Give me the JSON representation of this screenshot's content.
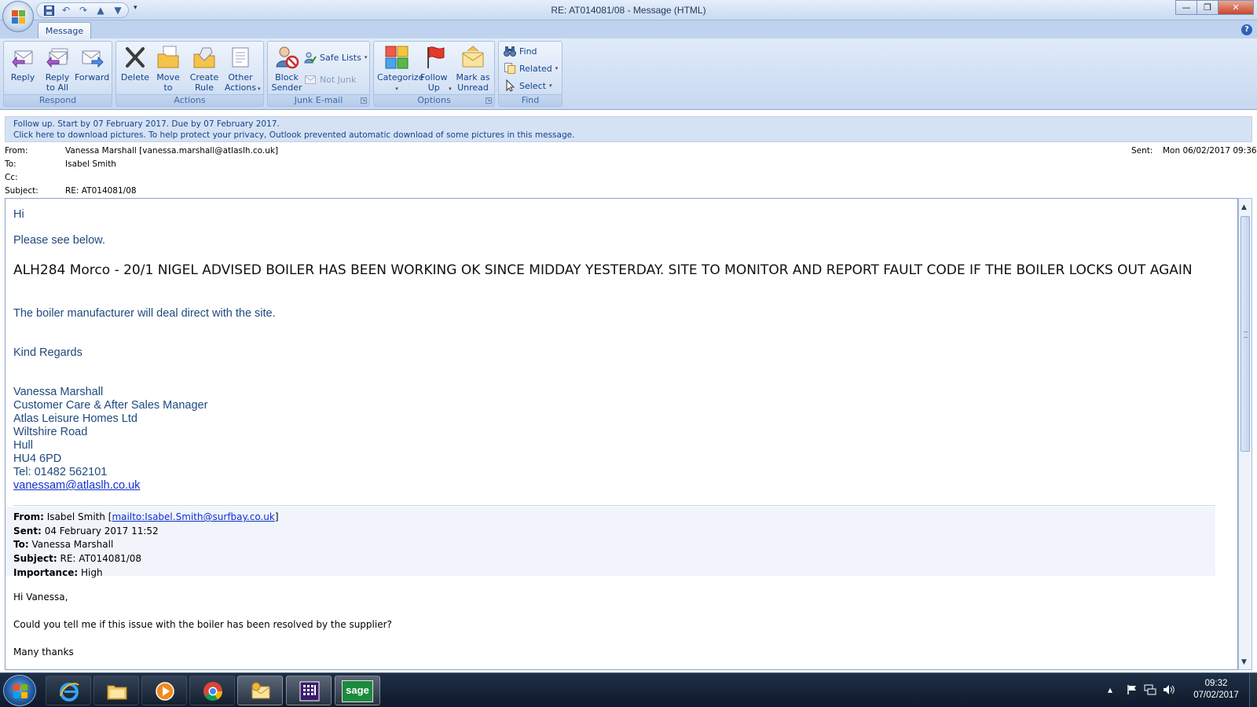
{
  "window": {
    "title": "RE: AT014081/08 - Message (HTML)",
    "minimize_glyph": "—",
    "maximize_glyph": "❐",
    "close_glyph": "✕",
    "qat_more_glyph": "▾"
  },
  "ribbon": {
    "tab": "Message",
    "help_glyph": "?",
    "groups": {
      "respond": {
        "label": "Respond",
        "reply": "Reply",
        "reply_all": "Reply to All",
        "forward": "Forward"
      },
      "actions": {
        "label": "Actions",
        "delete": "Delete",
        "move_to_folder": "Move to Folder",
        "create_rule": "Create Rule",
        "other_actions": "Other Actions"
      },
      "junk": {
        "label": "Junk E-mail",
        "block_sender": "Block Sender",
        "safe_lists": "Safe Lists",
        "not_junk": "Not Junk"
      },
      "options": {
        "label": "Options",
        "categorize": "Categorize",
        "follow_up": "Follow Up",
        "mark_unread": "Mark as Unread"
      },
      "find": {
        "label": "Find",
        "find": "Find",
        "related": "Related",
        "select": "Select"
      }
    }
  },
  "infobar": {
    "line1": "Follow up.  Start by 07 February 2017.  Due by 07 February 2017.",
    "line2": "Click here to download pictures. To help protect your privacy, Outlook prevented automatic download of some pictures in this message."
  },
  "header": {
    "from_label": "From:",
    "from_value": "Vanessa Marshall [vanessa.marshall@atlaslh.co.uk]",
    "to_label": "To:",
    "to_value": "Isabel Smith",
    "cc_label": "Cc:",
    "cc_value": "",
    "subject_label": "Subject:",
    "subject_value": "RE: AT014081/08",
    "sent_label": "Sent:",
    "sent_value": "Mon 06/02/2017 09:36"
  },
  "message": {
    "greeting": "Hi",
    "intro": "Please see below.",
    "heading": "ALH284 Morco - 20/1 NIGEL ADVISED BOILER HAS BEEN WORKING OK SINCE MIDDAY YESTERDAY.  SITE TO MONITOR AND REPORT FAULT CODE IF THE BOILER LOCKS OUT AGAIN",
    "manufacturer_note": "The boiler manufacturer will deal direct with the site.",
    "regards": "Kind Regards",
    "signature": {
      "name": "Vanessa Marshall",
      "title": "Customer Care & After Sales Manager",
      "company": "Atlas Leisure Homes Ltd",
      "address1": "Wiltshire Road",
      "address2": "Hull",
      "postcode": "HU4 6PD",
      "tel": "Tel: 01482 562101",
      "email": "vanessam@atlaslh.co.uk"
    }
  },
  "quoted": {
    "from_label": "From:",
    "from_name": "Isabel Smith [",
    "from_link": "mailto:Isabel.Smith@surfbay.co.uk",
    "from_close": "]",
    "sent_label": "Sent:",
    "sent_value": "04 February 2017 11:52",
    "to_label": "To:",
    "to_value": "Vanessa Marshall",
    "subject_label": "Subject:",
    "subject_value": "RE: AT014081/08",
    "importance_label": "Importance:",
    "importance_value": "High",
    "greeting": "Hi Vanessa,",
    "question": "Could you tell me if this issue with the boiler has been resolved by the supplier?",
    "thanks": "Many thanks"
  },
  "taskbar": {
    "apps": [
      "internet-explorer",
      "windows-explorer",
      "media-player",
      "chrome",
      "outlook",
      "calculator-app",
      "sage"
    ],
    "sage_label": "sage",
    "tray_up_glyph": "▴",
    "time": "09:32",
    "date": "07/02/2017"
  }
}
